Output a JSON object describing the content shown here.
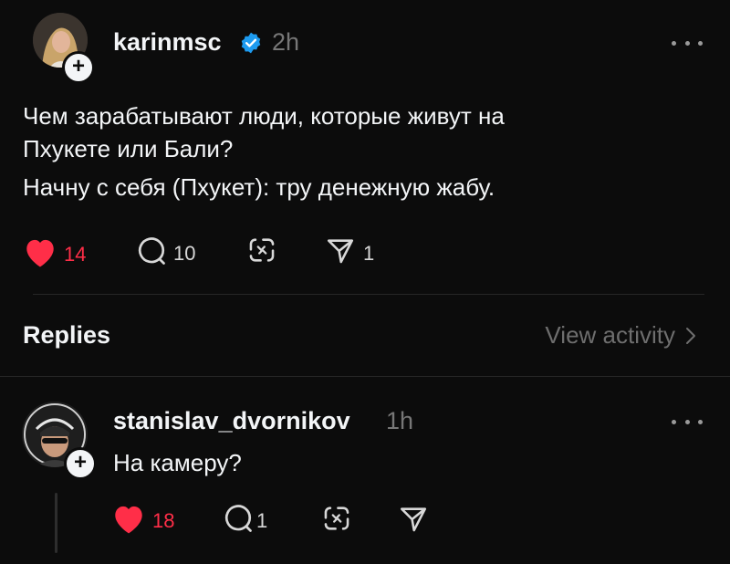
{
  "post": {
    "username": "karinmsc",
    "time": "2h",
    "text_lines": [
      "Чем зарабатывают люди, которые живут на",
      "Пхукете или Бали?",
      "Начну с себя (Пхукет): тру денежную жабу."
    ],
    "likes": "14",
    "comments": "10",
    "shares": "1",
    "liked": true
  },
  "section": {
    "replies_label": "Replies",
    "view_activity_label": "View activity"
  },
  "reply": {
    "username": "stanislav_dvornikov",
    "time": "1h",
    "text": "На камеру?",
    "likes": "18",
    "comments": "1"
  },
  "colors": {
    "background": "#0c0c0c",
    "text": "#f3f5f7",
    "muted": "#777777",
    "like": "#ff2e48",
    "verified": "#1d9bf0"
  },
  "icons": {
    "verified": "verified-badge-icon",
    "like": "heart-icon",
    "comment": "comment-bubble-icon",
    "repost": "repost-icon",
    "share": "send-icon",
    "more": "more-dots-icon",
    "chevron": "chevron-right-icon"
  }
}
